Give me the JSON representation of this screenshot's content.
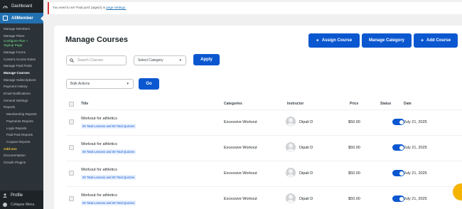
{
  "sidebar": {
    "dashboard": "Dashboard",
    "plugin": "AllMember",
    "items": [
      {
        "label": "Manage Members",
        "style": "normal"
      },
      {
        "label": "Manage Plans",
        "style": "normal"
      },
      {
        "label": "Configure Plan +",
        "style": "green"
      },
      {
        "label": "Signup Page",
        "style": "green-wrap"
      },
      {
        "label": "Manage Forms",
        "style": "normal"
      },
      {
        "label": "Content Access Rules",
        "style": "normal"
      },
      {
        "label": "Manage Paid Posts",
        "style": "normal"
      },
      {
        "label": "Manage Courses",
        "style": "current"
      },
      {
        "label": "Manage Subscriptions",
        "style": "normal"
      },
      {
        "label": "Payment History",
        "style": "normal"
      },
      {
        "label": "Email Notifications",
        "style": "normal"
      },
      {
        "label": "General Settings",
        "style": "normal"
      },
      {
        "label": "Reports",
        "style": "normal"
      },
      {
        "label": "Membership Reports",
        "style": "indent"
      },
      {
        "label": "Payments Reports",
        "style": "indent"
      },
      {
        "label": "Login Reports",
        "style": "indent"
      },
      {
        "label": "Paid Post Reports",
        "style": "indent"
      },
      {
        "label": "Coupon Reports",
        "style": "indent"
      },
      {
        "label": "Add-ons",
        "style": "addons"
      },
      {
        "label": "Documentation",
        "style": "normal"
      },
      {
        "label": "Growth Plugins",
        "style": "normal"
      }
    ],
    "profile": "Profile",
    "collapse": "Collapse Menu"
  },
  "notice": {
    "text": "You need to set 'Paid post' page(s) in",
    "link": "page settings."
  },
  "main": {
    "title": "Manage Courses",
    "assign_btn": "Assign Course",
    "category_btn": "Manage Category",
    "add_btn": "Add Course",
    "search_placeholder": "Search Courses",
    "category_select": "Select Category",
    "apply_btn": "Apply",
    "bulk_select": "Bulk Actions",
    "go_btn": "Go"
  },
  "table": {
    "headers": {
      "title": "Title",
      "categories": "Categories",
      "instructor": "Instructor",
      "price": "Price",
      "status": "Status",
      "date": "Date"
    },
    "rows": [
      {
        "title": "Workout for athletics",
        "lessons": "00 Total Lessons and 00 Total Quizzes",
        "category": "Excessive Workout",
        "instructor": "Dipali D",
        "price": "$50.00",
        "date": "July 21, 2025",
        "status_on": true
      },
      {
        "title": "Workout for athletics",
        "lessons": "00 Total Lessons and 00 Total Quizzes",
        "category": "Excessive Workout",
        "instructor": "Dipali D",
        "price": "$50.00",
        "date": "July 21, 2025",
        "status_on": true
      },
      {
        "title": "Workout for athletics",
        "lessons": "00 Total Lessons and 00 Total Quizzes",
        "category": "Excessive Workout",
        "instructor": "Dipali D",
        "price": "$50.00",
        "date": "July 21, 2025",
        "status_on": true
      },
      {
        "title": "Workout for athletics",
        "lessons": "00 Total Lessons and 00 Total Quizzes",
        "category": "Excessive Workout",
        "instructor": "Dipali D",
        "price": "$50.00",
        "date": "July 21, 2025",
        "status_on": true
      }
    ]
  },
  "colors": {
    "primary": "#0b57d0",
    "sidebar_bg": "#1d2327",
    "wp_blue": "#2271b1",
    "notice_border": "#d63638",
    "addons": "#f0c33c",
    "fab": "#f4b400"
  }
}
